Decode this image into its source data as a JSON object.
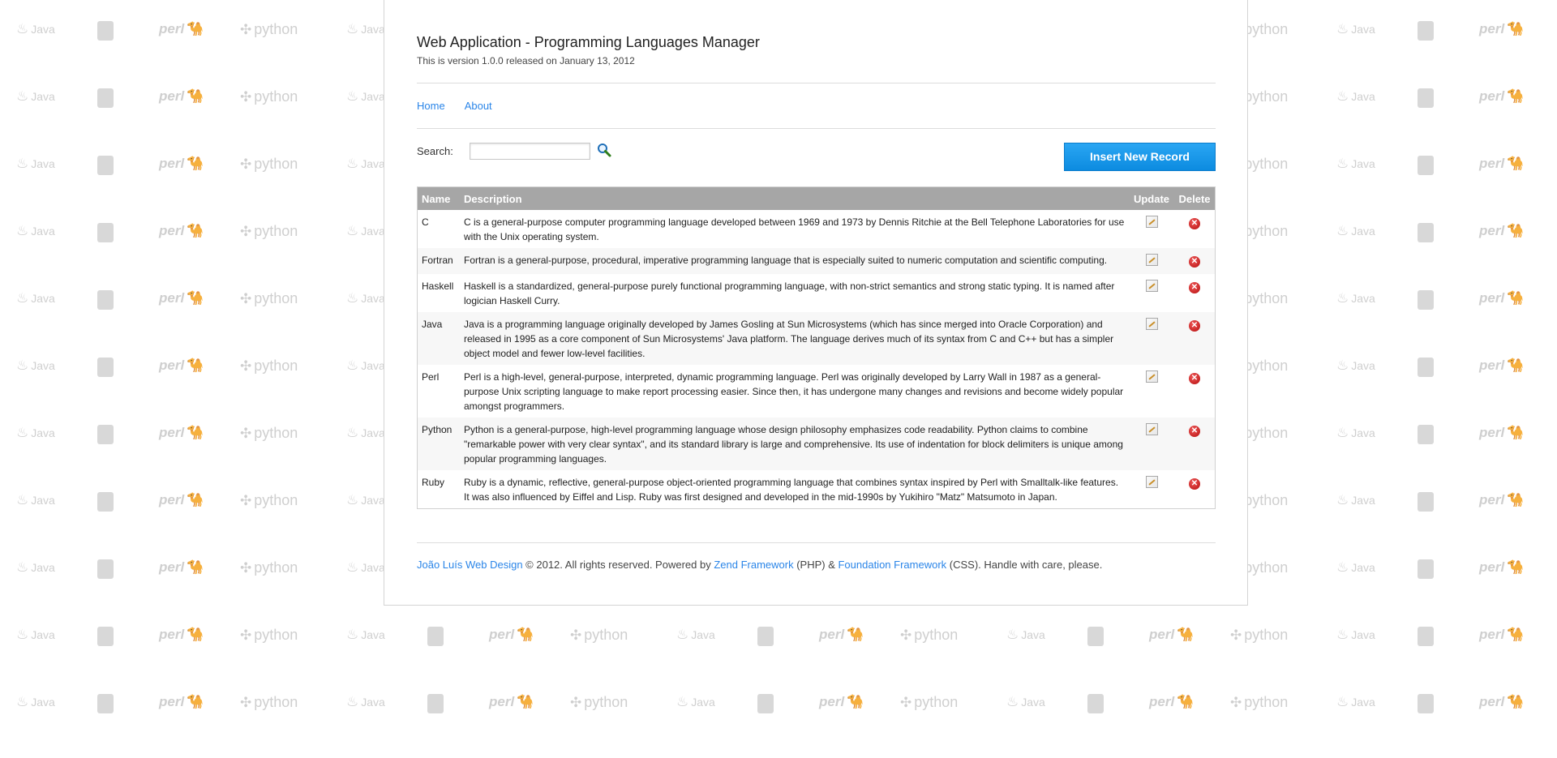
{
  "header": {
    "title": "Web Application - Programming Languages Manager",
    "subtitle": "This is version 1.0.0 released on January 13, 2012"
  },
  "nav": {
    "items": [
      {
        "label": "Home"
      },
      {
        "label": "About"
      }
    ]
  },
  "search": {
    "label": "Search:",
    "value": "",
    "placeholder": "",
    "icon": "magnifier-icon"
  },
  "insert_button": {
    "label": "Insert New Record"
  },
  "table": {
    "headers": {
      "name": "Name",
      "description": "Description",
      "update": "Update",
      "delete": "Delete"
    },
    "rows": [
      {
        "name": "C",
        "description": "C is a general-purpose computer programming language developed between 1969 and 1973 by Dennis Ritchie at the Bell Telephone Laboratories for use with the Unix operating system."
      },
      {
        "name": "Fortran",
        "description": "Fortran is a general-purpose, procedural, imperative programming language that is especially suited to numeric computation and scientific computing."
      },
      {
        "name": "Haskell",
        "description": "Haskell is a standardized, general-purpose purely functional programming language, with non-strict semantics and strong static typing. It is named after logician Haskell Curry."
      },
      {
        "name": "Java",
        "description": "Java is a programming language originally developed by James Gosling at Sun Microsystems (which has since merged into Oracle Corporation) and released in 1995 as a core component of Sun Microsystems' Java platform. The language derives much of its syntax from C and C++ but has a simpler object model and fewer low-level facilities."
      },
      {
        "name": "Perl",
        "description": "Perl is a high-level, general-purpose, interpreted, dynamic programming language. Perl was originally developed by Larry Wall in 1987 as a general-purpose Unix scripting language to make report processing easier. Since then, it has undergone many changes and revisions and become widely popular amongst programmers."
      },
      {
        "name": "Python",
        "description": "Python is a general-purpose, high-level programming language whose design philosophy emphasizes code readability. Python claims to combine \"remarkable power with very clear syntax\", and its standard library is large and comprehensive. Its use of indentation for block delimiters is unique among popular programming languages."
      },
      {
        "name": "Ruby",
        "description": "Ruby is a dynamic, reflective, general-purpose object-oriented programming language that combines syntax inspired by Perl with Smalltalk-like features. It was also influenced by Eiffel and Lisp. Ruby was first designed and developed in the mid-1990s by Yukihiro \"Matz\" Matsumoto in Japan."
      }
    ]
  },
  "footer": {
    "author_link": "João Luís Web Design",
    "text_1": " © 2012. All rights reserved. Powered by ",
    "zend_link": "Zend Framework",
    "text_2": " (PHP) & ",
    "foundation_link": "Foundation Framework",
    "text_3": " (CSS). Handle with care, please."
  },
  "background": {
    "logos": [
      "java",
      "box",
      "perl",
      "python"
    ],
    "labels": {
      "java": "Java",
      "perl": "perl",
      "python": "python"
    }
  },
  "colors": {
    "link": "#2a85e8",
    "button": "#1a9bf0",
    "table_header": "#a6a6a6",
    "delete_icon": "#cc1a1a"
  }
}
